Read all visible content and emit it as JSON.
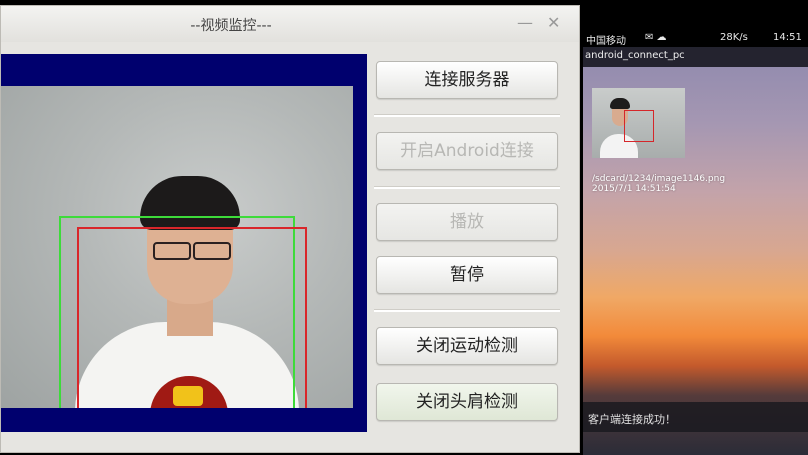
{
  "window": {
    "title": "--视频监控---",
    "minimize_glyph": "—",
    "close_glyph": "✕"
  },
  "buttons": {
    "connect_server": "连接服务器",
    "open_android": "开启Android连接",
    "play": "播放",
    "pause": "暂停",
    "close_motion": "关闭运动检测",
    "close_headshoulder": "关闭头肩检测"
  },
  "phone": {
    "status": {
      "carrier": "中国移动",
      "icons": "✉ ☁",
      "speed": "28K/s",
      "time": "14:51"
    },
    "app_title": "android_connect_pc",
    "file_path": "/sdcard/1234/image1146.png",
    "file_time": "2015/7/1 14:51:54",
    "toast": "客户端连接成功！"
  },
  "colors": {
    "video_background": "#00006e",
    "motion_box": "#3ddb3a",
    "headshoulder_box": "#d9262a"
  }
}
